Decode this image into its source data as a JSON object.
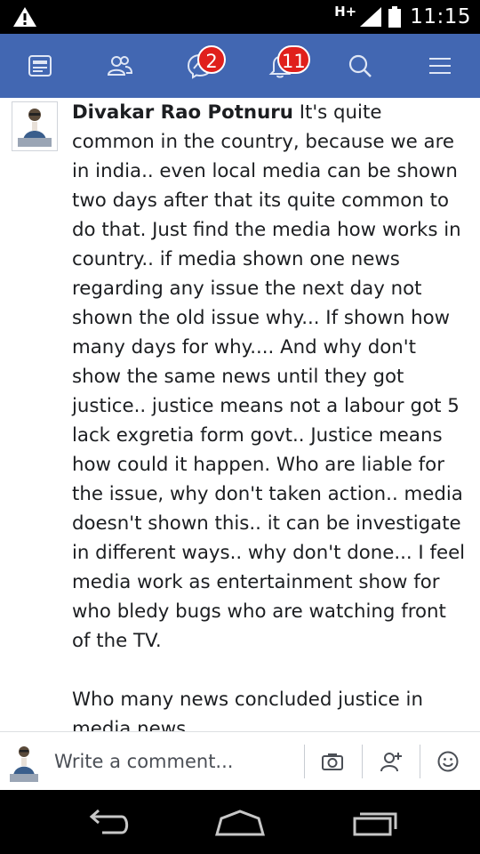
{
  "status_bar": {
    "network_type": "H+",
    "time": "11:15",
    "icons": [
      "warning-icon",
      "signal-icon",
      "battery-icon"
    ]
  },
  "nav_bar": {
    "color": "#4267b2",
    "items": [
      {
        "name": "news-feed-icon"
      },
      {
        "name": "friends-icon"
      },
      {
        "name": "messenger-icon",
        "badge": "2"
      },
      {
        "name": "notifications-icon",
        "badge": "11"
      },
      {
        "name": "search-icon"
      },
      {
        "name": "menu-icon"
      }
    ]
  },
  "comment": {
    "author": "Divakar Rao Potnuru",
    "text": " It's quite common in the country, because we are in india.. even local media can be shown two days after that its quite common to do that. Just find the media how works in country.. if media shown one news regarding any issue the next day not shown the old issue why... If shown how many days for why.... And why don't show the same news until they got justice.. justice means not a labour got 5 lack exgretia form govt.. Justice means how could it happen. Who are liable for the issue, why don't taken action.. media doesn't shown this.. it can be investigate in different ways.. why don't done... I feel media work as entertainment show for who bledy bugs who are watching front of the TV.\n\nWho many news concluded justice in media news..."
  },
  "composer": {
    "placeholder": "Write a comment...",
    "buttons": [
      "camera-icon",
      "tag-friend-icon",
      "emoji-icon"
    ]
  },
  "system_nav": [
    "back-icon",
    "home-icon",
    "recent-apps-icon"
  ]
}
